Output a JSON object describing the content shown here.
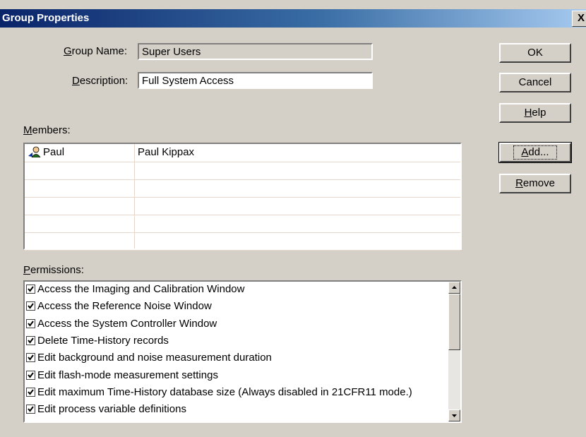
{
  "window": {
    "title": "Group Properties",
    "close_label": "X"
  },
  "form": {
    "group_name_label": "Group Name:",
    "group_name_value": "Super Users",
    "description_label": "Description:",
    "description_value": "Full System Access",
    "members_label": "Members:",
    "permissions_label": "Permissions:"
  },
  "buttons": {
    "ok": "OK",
    "cancel": "Cancel",
    "help": "Help",
    "add": "Add...",
    "remove": "Remove"
  },
  "members": [
    {
      "user": "Paul",
      "full_name": "Paul Kippax",
      "icon": "user-icon"
    },
    {
      "user": "",
      "full_name": ""
    },
    {
      "user": "",
      "full_name": ""
    },
    {
      "user": "",
      "full_name": ""
    },
    {
      "user": "",
      "full_name": ""
    },
    {
      "user": "",
      "full_name": ""
    }
  ],
  "permissions": [
    {
      "label": "Access the Imaging and Calibration Window",
      "checked": true
    },
    {
      "label": "Access the Reference Noise Window",
      "checked": true
    },
    {
      "label": "Access the System Controller Window",
      "checked": true
    },
    {
      "label": "Delete Time-History records",
      "checked": true
    },
    {
      "label": "Edit background and noise measurement duration",
      "checked": true
    },
    {
      "label": "Edit flash-mode measurement settings",
      "checked": true
    },
    {
      "label": "Edit maximum Time-History database size (Always disabled in 21CFR11 mode.)",
      "checked": true
    },
    {
      "label": "Edit process variable definitions",
      "checked": true
    }
  ]
}
